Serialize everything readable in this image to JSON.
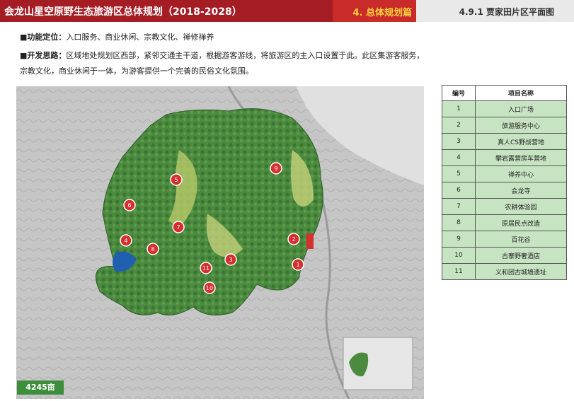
{
  "header": {
    "title": "会龙山星空原野生态旅游区总体规划（2018-2028）",
    "chapter": "4. 总体规划篇",
    "section": "4.9.1 贾家田片区平面图"
  },
  "description": {
    "function_label": "■功能定位：",
    "function_text": "入口服务、商业休闲、宗教文化、禅修禅养",
    "concept_label": "■开发思路：",
    "concept_line1": "区域地处规划区西部，紧邻交通主干道，根据游客游线，将旅游区的主入口设置于此。此区集游客服务，",
    "concept_line2": "宗教文化，商业休闲于一体，为游客提供一个完善的民俗文化氛围。"
  },
  "map": {
    "area_label": "4245亩",
    "markers": [
      "1",
      "2",
      "3",
      "4",
      "5",
      "6",
      "7",
      "8",
      "9",
      "10",
      "11"
    ]
  },
  "legend": {
    "header_no": "编号",
    "header_name": "项目名称",
    "items": [
      {
        "no": "1",
        "name": "入口广场"
      },
      {
        "no": "2",
        "name": "旅游服务中心"
      },
      {
        "no": "3",
        "name": "真人CS野战营地"
      },
      {
        "no": "4",
        "name": "攀岩露营房车营地"
      },
      {
        "no": "5",
        "name": "禅养中心"
      },
      {
        "no": "6",
        "name": "会龙寺"
      },
      {
        "no": "7",
        "name": "农耕体验园"
      },
      {
        "no": "8",
        "name": "原居民点改造"
      },
      {
        "no": "9",
        "name": "百花谷"
      },
      {
        "no": "10",
        "name": "古寨野奢酒店"
      },
      {
        "no": "11",
        "name": "义和团古城墙遗址"
      }
    ]
  },
  "colors": {
    "header_red": "#a51d24",
    "chapter_yellow": "#ffd43b",
    "marker_red": "#d62f2f",
    "forest_green": "#3f7f3a",
    "legend_green": "#c7e4c2"
  }
}
